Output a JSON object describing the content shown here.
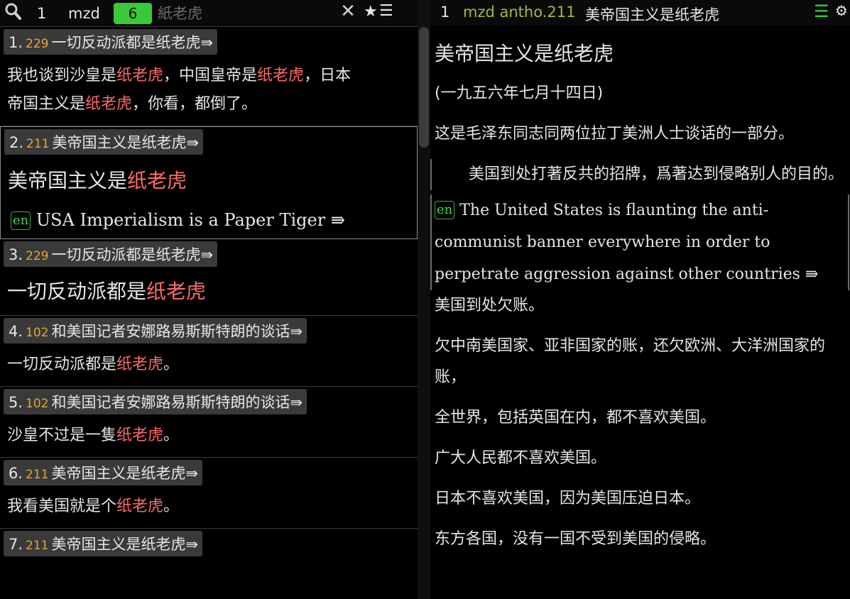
{
  "left": {
    "top": {
      "number": "1",
      "collection": "mzd",
      "hit_count": "6",
      "search_placeholder": "紙老虎",
      "clear_label": "✕",
      "star_label": "★",
      "menu_label": "☰"
    },
    "results": [
      {
        "num": "1.",
        "code": "229",
        "title": "一切反动派都是纸老虎⇛",
        "snippet": [
          {
            "a": "我也谈到沙皇是",
            "h": "纸老虎",
            "b": "，中国皇帝是",
            "h2": "纸老虎",
            "c": "，日本"
          },
          {
            "a": "帝国主义是",
            "h": "纸老虎",
            "b": "，你看，都倒了。"
          }
        ]
      },
      {
        "num": "2.",
        "code": "211",
        "title": "美帝国主义是纸老虎⇛",
        "heading": {
          "a": "美帝国主义是",
          "h": "纸老虎"
        },
        "en_badge": "en",
        "en_text": "USA Imperialism is a Paper Tiger ⇛"
      },
      {
        "num": "3.",
        "code": "229",
        "title": "一切反动派都是纸老虎⇛",
        "heading": {
          "a": "一切反动派都是",
          "h": "纸老虎"
        }
      },
      {
        "num": "4.",
        "code": "102",
        "title": "和美国记者安娜路易斯斯特朗的谈话⇛",
        "line": {
          "a": "一切反动派都是",
          "h": "纸老虎",
          "b": "。"
        }
      },
      {
        "num": "5.",
        "code": "102",
        "title": "和美国记者安娜路易斯斯特朗的谈话⇛",
        "line": {
          "a": "沙皇不过是一隻",
          "h": "纸老虎",
          "b": "。"
        }
      },
      {
        "num": "6.",
        "code": "211",
        "title": "美帝国主义是纸老虎⇛",
        "line": {
          "a": "我看美国就是个",
          "h": "纸老虎",
          "b": "。"
        }
      },
      {
        "num": "7.",
        "code": "211",
        "title": "美帝国主义是纸老虎⇛"
      }
    ]
  },
  "right": {
    "top": {
      "number": "1",
      "collection": "mzd antho.211",
      "title": "美帝国主义是纸老虎",
      "menu_label": "☰",
      "gear_label": "⚙"
    },
    "heading": "美帝国主义是纸老虎",
    "date": "(一九五六年七月十四日)",
    "intro": "这是毛泽东同志同两位拉丁美洲人士谈话的一部分。",
    "quote": "美国到处打著反共的招牌，爲著达到侵略别人的目的。",
    "en_badge": "en",
    "en_text": "The United States is flaunting the anti-communist banner everywhere in order to perpetrate aggression against other countries ⇛",
    "paragraphs": [
      "美国到处欠账。",
      "欠中南美国家、亚非国家的账，还欠欧洲、大洋洲国家的账，",
      "全世界，包括英国在内，都不喜欢美国。",
      "广大人民都不喜欢美国。",
      "日本不喜欢美国，因为美国压迫日本。",
      "东方各国，没有一国不受到美国的侵略。"
    ]
  },
  "colors": {
    "highlight": "#ff6b6b",
    "accent_green": "#39c939",
    "code_orange": "#e2a63b",
    "collection_olive": "#9fba38"
  }
}
